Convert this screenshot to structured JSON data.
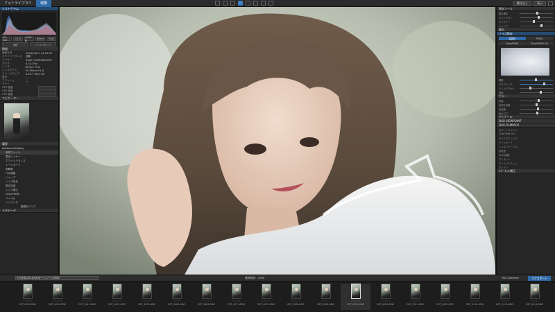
{
  "topbar": {
    "tabs": [
      "フォトライブラリ",
      "現像"
    ],
    "right_buttons": [
      "書き出し",
      "表示"
    ],
    "tools": [
      "crop-tool",
      "rotate-tool",
      "repair-tool",
      "brush-tool",
      "gradient-tool",
      "eyedropper-tool",
      "compare-tool",
      "zoom-tool"
    ]
  },
  "left": {
    "sections": {
      "histogram": "ヒストグラム",
      "info": "情報",
      "navigator": "ナビゲーター",
      "history": "履歴",
      "metadata": "メタデータ"
    },
    "info_buttons_1": [
      "ISO 100",
      "f/1.8",
      "1/400秒",
      "85mm",
      "RAW"
    ],
    "info_buttons_2": [
      "比較",
      "ソフトプルーフ"
    ],
    "info_rows": [
      {
        "label": "撮影日時",
        "value": "2024/04/21 14:35:03"
      },
      {
        "label": "ホワイトバランス",
        "value": "自動"
      },
      {
        "label": "メーカー",
        "value": "SONY CORPORATION"
      },
      {
        "label": "カメラ",
        "value": "ILCE-7M4"
      },
      {
        "label": "レンズ",
        "value": "85mm F1.8"
      },
      {
        "label": "レンズモデル",
        "value": "FE 85mm F1.8"
      },
      {
        "label": "ファームウェア",
        "value": "ILCE-7 Ver.2.00"
      },
      {
        "label": "露出",
        "value": "—"
      },
      {
        "label": "フラッシュ",
        "value": "—"
      },
      {
        "label": "モード",
        "value": "—"
      }
    ],
    "gps_rows": [
      "GPS 緯度",
      "GPS 経度",
      "GPS 高度"
    ],
    "history_title": "Advanced History",
    "history_items": [
      "新規ファイル",
      "露出レイヤー",
      "ホワイトバランス",
      "トーンカーブ",
      "明瞭度",
      "HSL調整",
      "シャープ",
      "ノイズ除去",
      "周辺光量",
      "レンズ補正",
      "DeepPRIME",
      "フィルム",
      "トリミング"
    ],
    "history_footer": "履歴をクリア"
  },
  "right": {
    "sections": [
      "基本ツール",
      "露出",
      "ノイズ除去",
      "カラー",
      "ディテール",
      "DXO VIEWPOINT",
      "DXO FILMPACK",
      "ローカル補正"
    ],
    "seg_buttons": [
      "高品質",
      "PRIME",
      "DeepPRIME",
      "DeepPRIME XD"
    ],
    "sliders_top": [
      "露光補正",
      "コントラスト",
      "ハイライト",
      "シャドウ"
    ],
    "sliders_mid": [
      "輝度",
      "クロミナンス",
      "デッドピクセル",
      "強度"
    ],
    "sliders_low": [
      "彩度",
      "自然な彩度",
      "色温度",
      "色かぶり"
    ],
    "extra_rows": [
      "スマートライティング",
      "ClearView Plus",
      "マイクロコントラスト",
      "トーンカーブ",
      "レンズシャープネス",
      "色収差",
      "ゆがみ補正",
      "ヴィネット",
      "フィルムエミュレーション",
      "グレイン"
    ]
  },
  "filmbar": {
    "path": "D:\\写真\\2024\\04\\ポートレート\\RAW",
    "selection": "選択枚数：1/500",
    "collection": "My Collection",
    "export": "エクスポート"
  },
  "filmstrip": [
    {
      "name": "DST_4038.ARW",
      "selected": false
    },
    {
      "name": "DST_4042.ARW",
      "selected": false
    },
    {
      "name": "DST_4047.ARW",
      "selected": false
    },
    {
      "name": "DST_4051.ARW",
      "selected": false
    },
    {
      "name": "DST_4055.ARW",
      "selected": false
    },
    {
      "name": "DST_4060.ARW",
      "selected": false
    },
    {
      "name": "DST_4066.ARW",
      "selected": false
    },
    {
      "name": "DST_4071.ARW",
      "selected": false
    },
    {
      "name": "DST_4075.ARW",
      "selected": false
    },
    {
      "name": "DST_4080.ARW",
      "selected": false
    },
    {
      "name": "DST_4084.ARW",
      "selected": false
    },
    {
      "name": "DST_4092.ARW",
      "selected": true
    },
    {
      "name": "DST_4096.ARW",
      "selected": false
    },
    {
      "name": "DST_4101.ARW",
      "selected": false
    },
    {
      "name": "DST_4105.ARW",
      "selected": false
    },
    {
      "name": "DST_4110.ARW",
      "selected": false
    },
    {
      "name": "DST_4114.ARW",
      "selected": false
    },
    {
      "name": "DST_4119.ARW",
      "selected": false
    }
  ],
  "colors": {
    "accent": "#2e6aa8",
    "panel": "#262626",
    "background": "#1a1a1a"
  }
}
